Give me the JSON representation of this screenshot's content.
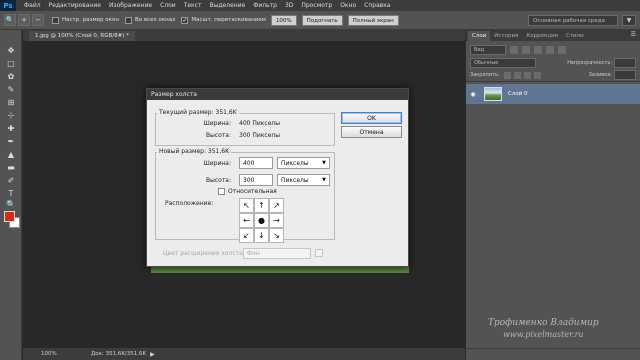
{
  "app": {
    "logo": "Ps"
  },
  "menu": [
    "Файл",
    "Редактирование",
    "Изображение",
    "Слои",
    "Текст",
    "Выделение",
    "Фильтр",
    "3D",
    "Просмотр",
    "Окно",
    "Справка"
  ],
  "options": {
    "resize_windows_label": "Настр. размер окон",
    "all_windows_label": "Во всех окнах",
    "scrubby_zoom_label": "Масшт. перетаскиванием",
    "scrubby_zoom_checked": true,
    "zoom_100_label": "100%",
    "fit_screen_label": "Подогнать",
    "full_screen_label": "Полный экран",
    "workspace_label": "Основная рабочая среда"
  },
  "document": {
    "tab_label": "1.jpg @ 100% (Слой 0, RGB/8#) *",
    "zoom": "100%",
    "doc_info": "Док: 351,6K/351,6K"
  },
  "tools": [
    "move-tool",
    "marquee-tool",
    "lasso-tool",
    "quick-select-tool",
    "crop-tool",
    "eyedropper-tool",
    "healing-tool",
    "brush-tool",
    "clone-stamp-tool",
    "history-brush-tool",
    "eraser-tool",
    "gradient-tool",
    "blur-tool",
    "dodge-tool",
    "pen-tool",
    "type-tool",
    "path-select-tool",
    "shape-tool",
    "hand-tool",
    "zoom-tool"
  ],
  "colors": {
    "foreground": "#e2231a",
    "background": "#ffffff",
    "layer_selected": "#5f7591"
  },
  "panels": {
    "tabs": [
      "Слои",
      "История",
      "Коррекция",
      "Стили"
    ],
    "active_tab": "Слои",
    "filter_kind": "Вид",
    "blend_mode": "Обычные",
    "opacity_label": "Непрозрачность:",
    "lock_label": "Закрепить:",
    "fill_label": "Заливка:",
    "layers": [
      {
        "name": "Слой 0",
        "visible": true
      }
    ]
  },
  "dialog": {
    "title": "Размер холста",
    "current_size_label": "Текущий размер: 351,6K",
    "current_width_label": "Ширина:",
    "current_width_value": "400 Пикселы",
    "current_height_label": "Высота:",
    "current_height_value": "300 Пикселы",
    "new_size_label": "Новый размер: 351,6K",
    "width_label": "Ширина:",
    "width_value": "400",
    "width_unit": "Пикселы",
    "height_label": "Высота:",
    "height_value": "300",
    "height_unit": "Пикселы",
    "relative_label": "Относительная",
    "relative_checked": false,
    "anchor_label": "Расположение:",
    "extension_label": "Цвет расширения холста:",
    "extension_value": "Фон",
    "ok_label": "OK",
    "cancel_label": "Отмена"
  },
  "watermark": {
    "line1": "Трофименко Владимир",
    "line2": "www.pixelmaster.ru"
  }
}
